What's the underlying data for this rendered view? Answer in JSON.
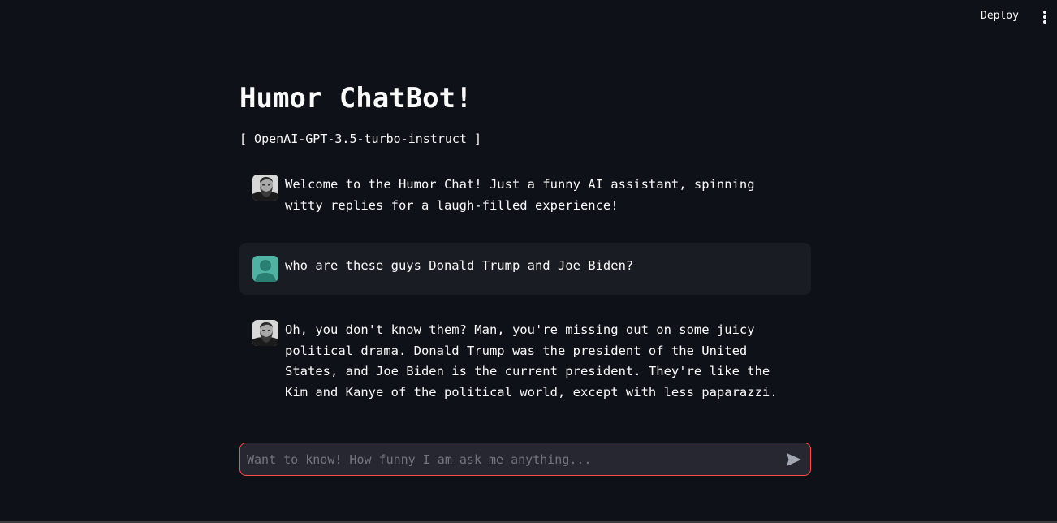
{
  "header": {
    "deploy_label": "Deploy",
    "menu_icon": "more-vertical-icon"
  },
  "page": {
    "title": "Humor ChatBot!",
    "subtitle": "[ OpenAI-GPT-3.5-turbo-instruct ]"
  },
  "messages": [
    {
      "role": "assistant",
      "avatar_icon": "bearded-man-avatar",
      "text": "Welcome to the Humor Chat! Just a funny AI assistant, spinning witty replies for a laugh-filled experience!"
    },
    {
      "role": "user",
      "avatar_icon": "user-avatar",
      "text": "who are these guys Donald Trump and Joe Biden?"
    },
    {
      "role": "assistant",
      "avatar_icon": "bearded-man-avatar",
      "text": "Oh, you don't know them? Man, you're missing out on some juicy political drama. Donald Trump was the president of the United States, and Joe Biden is the current president. They're like the Kim and Kanye of the political world, except with less paparazzi."
    }
  ],
  "chat_input": {
    "placeholder": "Want to know! How funny I am ask me anything...",
    "value": "",
    "send_icon": "send-icon"
  },
  "colors": {
    "background": "#0e1117",
    "user_bubble": "#1a1c24",
    "input_border": "#ff4b4b",
    "user_avatar": "#4fb3a4"
  }
}
